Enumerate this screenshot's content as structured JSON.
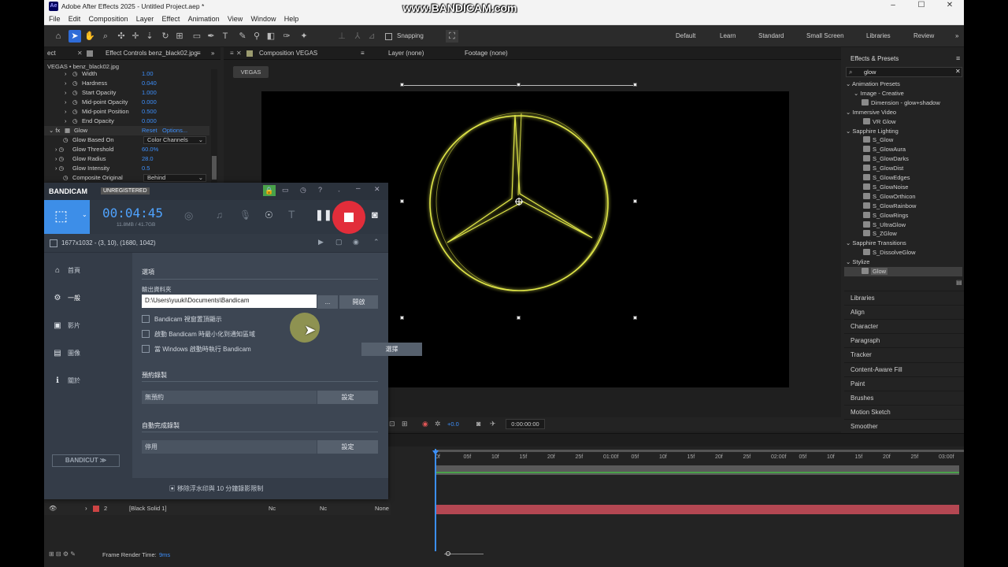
{
  "window": {
    "title": "Adobe After Effects 2025 - Untitled Project.aep *",
    "app_icon": "Ae",
    "watermark": "www.BANDICAM.com",
    "controls": [
      "–",
      "☐",
      "✕"
    ]
  },
  "menu": [
    "File",
    "Edit",
    "Composition",
    "Layer",
    "Effect",
    "Animation",
    "View",
    "Window",
    "Help"
  ],
  "toolbar": {
    "snapping": "Snapping",
    "workspaces": [
      "Default",
      "Learn",
      "Standard",
      "Small Screen",
      "Libraries",
      "Review"
    ]
  },
  "effect_controls": {
    "tab_left": "ect",
    "tab": "Effect Controls benz_black02.jpg",
    "layer": "VEGAS • benz_black02.jpg",
    "rows": [
      {
        "label": "Width",
        "value": "1.00",
        "indent": 3
      },
      {
        "label": "Hardness",
        "value": "0.040",
        "indent": 3
      },
      {
        "label": "Start Opacity",
        "value": "1.000",
        "indent": 3
      },
      {
        "label": "Mid-point Opacity",
        "value": "0.000",
        "indent": 3
      },
      {
        "label": "Mid-point Position",
        "value": "0.500",
        "indent": 3
      },
      {
        "label": "End Opacity",
        "value": "0.000",
        "indent": 3
      }
    ],
    "glow": {
      "label": "Glow",
      "reset": "Reset",
      "options": "Options..."
    },
    "glow_rows": [
      {
        "label": "Glow Based On",
        "select": "Color Channels"
      },
      {
        "label": "Glow Threshold",
        "value": "60.0%"
      },
      {
        "label": "Glow Radius",
        "value": "28.0"
      },
      {
        "label": "Glow Intensity",
        "value": "0.5"
      },
      {
        "label": "Composite Original",
        "select": "Behind"
      }
    ]
  },
  "composition": {
    "tab": "Composition VEGAS",
    "layer_tab": "Layer (none)",
    "footage_tab": "Footage (none)",
    "chip": "VEGAS",
    "timecode": "0:00:00:00",
    "exposure": "+0.0"
  },
  "effects_presets": {
    "title": "Effects & Presets",
    "search": "glow",
    "tree": [
      {
        "text": "Animation Presets",
        "level": 0,
        "kind": "folder"
      },
      {
        "text": "Image - Creative",
        "level": 1,
        "kind": "folder"
      },
      {
        "text": "Dimension - glow+shadow",
        "level": 2,
        "kind": "item"
      },
      {
        "text": "Immersive Video",
        "level": 0,
        "kind": "folder"
      },
      {
        "text": "VR Glow",
        "level": 1,
        "kind": "item"
      },
      {
        "text": "Sapphire Lighting",
        "level": 0,
        "kind": "folder"
      },
      {
        "text": "S_Glow",
        "level": 1,
        "kind": "item"
      },
      {
        "text": "S_GlowAura",
        "level": 1,
        "kind": "item"
      },
      {
        "text": "S_GlowDarks",
        "level": 1,
        "kind": "item"
      },
      {
        "text": "S_GlowDist",
        "level": 1,
        "kind": "item"
      },
      {
        "text": "S_GlowEdges",
        "level": 1,
        "kind": "item"
      },
      {
        "text": "S_GlowNoise",
        "level": 1,
        "kind": "item"
      },
      {
        "text": "S_GlowOrthicon",
        "level": 1,
        "kind": "item"
      },
      {
        "text": "S_GlowRainbow",
        "level": 1,
        "kind": "item"
      },
      {
        "text": "S_GlowRings",
        "level": 1,
        "kind": "item"
      },
      {
        "text": "S_UltraGlow",
        "level": 1,
        "kind": "item"
      },
      {
        "text": "S_ZGlow",
        "level": 1,
        "kind": "item"
      },
      {
        "text": "Sapphire Transitions",
        "level": 0,
        "kind": "folder"
      },
      {
        "text": "S_DissolveGlow",
        "level": 1,
        "kind": "item"
      },
      {
        "text": "Stylize",
        "level": 0,
        "kind": "folder"
      },
      {
        "text": "Glow",
        "level": 1,
        "kind": "item"
      }
    ],
    "panels": [
      "Libraries",
      "Align",
      "Character",
      "Paragraph",
      "Tracker",
      "Content-Aware Fill",
      "Paint",
      "Brushes",
      "Motion Sketch",
      "Smoother"
    ]
  },
  "timeline": {
    "ruler": [
      "0f",
      "05f",
      "10f",
      "15f",
      "20f",
      "25f",
      "01:00f",
      "05f",
      "10f",
      "15f",
      "20f",
      "25f",
      "02:00f",
      "05f",
      "10f",
      "15f",
      "20f",
      "25f",
      "03:00f"
    ],
    "layer_num": "2",
    "layer_name": "[Black Solid 1]",
    "mode1": "Nc",
    "mode2": "Nc",
    "parent": "None",
    "frame_render_label": "Frame Render Time:",
    "frame_render_value": "9ms"
  },
  "bandicam": {
    "brand": "BANDICAM",
    "badge": "UNREGISTERED",
    "time": "00:04:45",
    "size": "11.8MB / 41.7GB",
    "region": "1677x1032 - (3, 10), (1680, 1042)",
    "nav": [
      {
        "icon": "home-icon",
        "glyph": "⌂",
        "label": "首頁"
      },
      {
        "icon": "gear-icon",
        "glyph": "⚙",
        "label": "一般"
      },
      {
        "icon": "video-icon",
        "glyph": "▣",
        "label": "影片"
      },
      {
        "icon": "image-icon",
        "glyph": "▤",
        "label": "圖像"
      },
      {
        "icon": "info-icon",
        "glyph": "ℹ",
        "label": "關於"
      }
    ],
    "section_options": "選項",
    "output_folder_label": "輸出資料夾",
    "output_folder": "D:\\Users\\yuuki\\Documents\\Bandicam",
    "browse": "...",
    "open": "開啟",
    "checks": [
      "Bandicam 視窗置頂顯示",
      "啟動 Bandicam 時最小化到通知區域",
      "當 Windows 啟動時執行 Bandicam"
    ],
    "apply": "選擇",
    "schedule_title": "預約錄製",
    "schedule_value": "無預約",
    "schedule_btn": "設定",
    "auto_title": "自動完成錄製",
    "auto_value": "停用",
    "auto_btn": "設定",
    "bandicut": "BANDICUT ≫",
    "footer": "移除浮水印與 10 分鐘錄影限制"
  }
}
